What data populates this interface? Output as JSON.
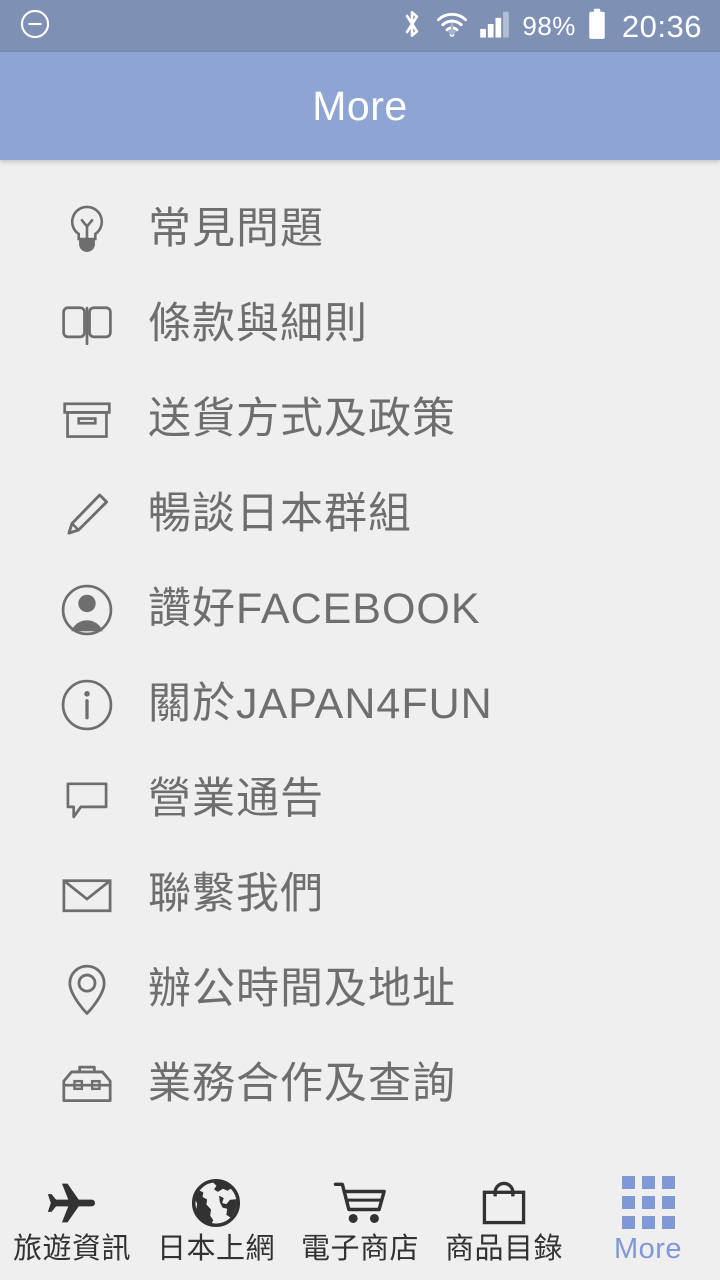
{
  "status_bar": {
    "left_icon": "circle-minus-icon",
    "icons": [
      "bluetooth-icon",
      "wifi-icon",
      "cellular-signal-icon"
    ],
    "battery_percent": "98%",
    "battery_icon": "battery-full-icon",
    "clock": "20:36",
    "background_color": "#7f90b5",
    "text_color": "#ffffff"
  },
  "header": {
    "title": "More",
    "background_color": "#8ea4d2",
    "text_color": "#ffffff"
  },
  "menu": {
    "background_color": "#efeff0",
    "text_color": "#6e6e6e",
    "items": [
      {
        "label": "常見問題",
        "icon": "lightbulb-icon"
      },
      {
        "label": "條款與細則",
        "icon": "open-book-icon"
      },
      {
        "label": "送貨方式及政策",
        "icon": "archive-box-icon"
      },
      {
        "label": "暢談日本群組",
        "icon": "pencil-icon"
      },
      {
        "label": "讚好FACEBOOK",
        "icon": "person-circle-icon"
      },
      {
        "label": "關於JAPAN4FUN",
        "icon": "info-circle-icon"
      },
      {
        "label": "營業通告",
        "icon": "speech-bubble-icon"
      },
      {
        "label": "聯繫我們",
        "icon": "envelope-icon"
      },
      {
        "label": "辦公時間及地址",
        "icon": "map-pin-icon"
      },
      {
        "label": "業務合作及查詢",
        "icon": "toolbox-icon"
      }
    ]
  },
  "bottom_nav": {
    "active_color": "#7e99d6",
    "inactive_color": "#323232",
    "items": [
      {
        "label": "旅遊資訊",
        "icon": "airplane-icon",
        "active": false
      },
      {
        "label": "日本上網",
        "icon": "globe-icon",
        "active": false
      },
      {
        "label": "電子商店",
        "icon": "shopping-cart-icon",
        "active": false
      },
      {
        "label": "商品目錄",
        "icon": "shopping-bag-icon",
        "active": false
      },
      {
        "label": "More",
        "icon": "grid-apps-icon",
        "active": true
      }
    ]
  }
}
